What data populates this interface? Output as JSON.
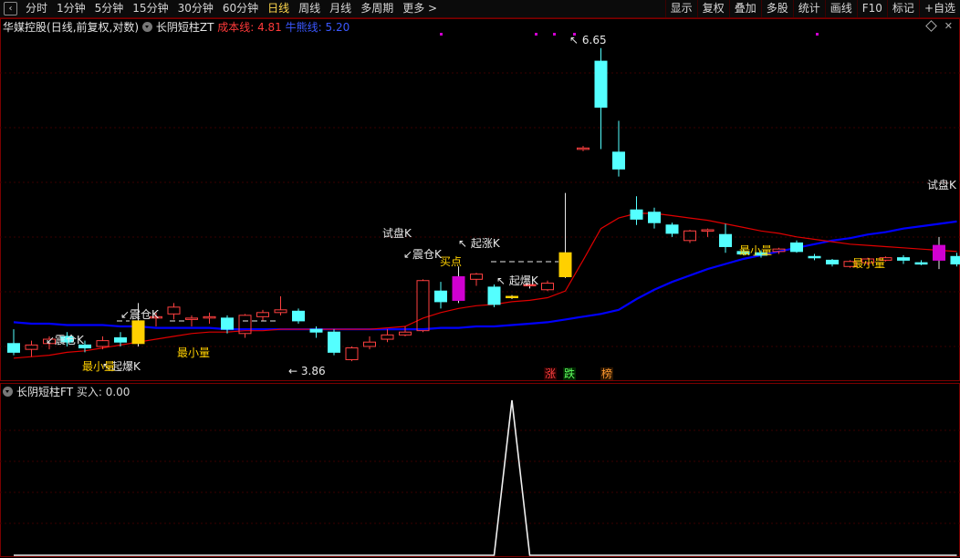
{
  "toolbar": {
    "left": [
      "分时",
      "1分钟",
      "5分钟",
      "15分钟",
      "30分钟",
      "60分钟",
      "日线",
      "周线",
      "月线",
      "多周期",
      "更多"
    ],
    "right": [
      "显示",
      "复权",
      "叠加",
      "多股",
      "统计",
      "画线",
      "F10",
      "标记",
      "+自选"
    ]
  },
  "header": {
    "stock_name": "华媒控股",
    "mode": "(日线,前复权,对数)",
    "indicator": "长阴短柱ZT",
    "cost_label": "成本线: 4.81",
    "bull_label": "牛熊线: 5.20"
  },
  "sub_header": {
    "indicator": "长阴短柱FT",
    "value_label": "买入: 0.00"
  },
  "annotations": {
    "high_price": "6.65",
    "low_price": "3.86",
    "shake_k": "震仓K",
    "trial_k": "试盘K",
    "surge_k": "起涨K",
    "burst_k": "起爆K",
    "min_volume": "最小量",
    "buy_point": "买点",
    "badge_rise": "涨",
    "badge_fall": "跌",
    "badge_list": "榜"
  },
  "colors": {
    "up": "#ff4040",
    "down": "#54ffff",
    "yellow": "#ffd000",
    "magenta": "#d000d0",
    "cost_line": "#e00000",
    "bull_line": "#0000ff",
    "white": "#e8e8e8"
  },
  "chart_data": {
    "type": "candlestick",
    "candles": [
      {
        "o": 3.98,
        "h": 4.08,
        "l": 3.9,
        "c": 3.92
      },
      {
        "o": 3.94,
        "h": 4.0,
        "l": 3.89,
        "c": 3.97
      },
      {
        "o": 3.98,
        "h": 4.03,
        "l": 3.94,
        "c": 4.01
      },
      {
        "o": 4.03,
        "h": 4.06,
        "l": 3.96,
        "c": 3.99
      },
      {
        "o": 3.97,
        "h": 4.0,
        "l": 3.92,
        "c": 3.95
      },
      {
        "o": 3.96,
        "h": 4.03,
        "l": 3.94,
        "c": 4.0
      },
      {
        "o": 4.02,
        "h": 4.06,
        "l": 3.96,
        "c": 3.99
      },
      {
        "o": 3.98,
        "h": 4.27,
        "l": 3.96,
        "c": 4.14,
        "color": "yellow"
      },
      {
        "o": 4.17,
        "h": 4.2,
        "l": 4.1,
        "c": 4.17
      },
      {
        "o": 4.19,
        "h": 4.27,
        "l": 4.15,
        "c": 4.24
      },
      {
        "o": 4.15,
        "h": 4.18,
        "l": 4.1,
        "c": 4.16
      },
      {
        "o": 4.16,
        "h": 4.2,
        "l": 4.12,
        "c": 4.17
      },
      {
        "o": 4.16,
        "h": 4.18,
        "l": 4.05,
        "c": 4.08
      },
      {
        "o": 4.05,
        "h": 4.19,
        "l": 4.02,
        "c": 4.18
      },
      {
        "o": 4.17,
        "h": 4.22,
        "l": 4.14,
        "c": 4.2
      },
      {
        "o": 4.2,
        "h": 4.32,
        "l": 4.18,
        "c": 4.22
      },
      {
        "o": 4.21,
        "h": 4.23,
        "l": 4.12,
        "c": 4.14
      },
      {
        "o": 4.08,
        "h": 4.1,
        "l": 4.02,
        "c": 4.06
      },
      {
        "o": 4.06,
        "h": 4.08,
        "l": 3.9,
        "c": 3.92
      },
      {
        "o": 3.87,
        "h": 3.96,
        "l": 3.86,
        "c": 3.95
      },
      {
        "o": 3.96,
        "h": 4.03,
        "l": 3.94,
        "c": 3.99
      },
      {
        "o": 4.01,
        "h": 4.08,
        "l": 3.99,
        "c": 4.04
      },
      {
        "o": 4.04,
        "h": 4.1,
        "l": 4.03,
        "c": 4.06
      },
      {
        "o": 4.07,
        "h": 4.45,
        "l": 4.06,
        "c": 4.44
      },
      {
        "o": 4.36,
        "h": 4.43,
        "l": 4.23,
        "c": 4.28
      },
      {
        "o": 4.29,
        "h": 4.55,
        "l": 4.27,
        "c": 4.47,
        "color": "magenta"
      },
      {
        "o": 4.45,
        "h": 4.5,
        "l": 4.4,
        "c": 4.49
      },
      {
        "o": 4.39,
        "h": 4.41,
        "l": 4.24,
        "c": 4.26
      },
      {
        "o": 4.31,
        "h": 4.33,
        "l": 4.3,
        "c": 4.32,
        "color": "yellow"
      },
      {
        "o": 4.4,
        "h": 4.42,
        "l": 4.38,
        "c": 4.41,
        "color": "red"
      },
      {
        "o": 4.37,
        "h": 4.44,
        "l": 4.36,
        "c": 4.42
      },
      {
        "o": 4.47,
        "h": 5.17,
        "l": 4.46,
        "c": 4.66,
        "color": "yellow"
      },
      {
        "o": 5.58,
        "h": 5.61,
        "l": 5.56,
        "c": 5.59
      },
      {
        "o": 6.5,
        "h": 6.65,
        "l": 5.58,
        "c": 6.0
      },
      {
        "o": 5.55,
        "h": 5.86,
        "l": 5.32,
        "c": 5.39
      },
      {
        "o": 5.02,
        "h": 5.14,
        "l": 4.89,
        "c": 4.94
      },
      {
        "o": 5.0,
        "h": 5.04,
        "l": 4.86,
        "c": 4.91
      },
      {
        "o": 4.89,
        "h": 4.91,
        "l": 4.79,
        "c": 4.82
      },
      {
        "o": 4.76,
        "h": 4.85,
        "l": 4.74,
        "c": 4.84
      },
      {
        "o": 4.84,
        "h": 4.86,
        "l": 4.79,
        "c": 4.85
      },
      {
        "o": 4.81,
        "h": 4.9,
        "l": 4.66,
        "c": 4.71
      },
      {
        "o": 4.67,
        "h": 4.69,
        "l": 4.64,
        "c": 4.65
      },
      {
        "o": 4.66,
        "h": 4.68,
        "l": 4.62,
        "c": 4.64
      },
      {
        "o": 4.67,
        "h": 4.7,
        "l": 4.65,
        "c": 4.69
      },
      {
        "o": 4.74,
        "h": 4.76,
        "l": 4.66,
        "c": 4.67
      },
      {
        "o": 4.63,
        "h": 4.65,
        "l": 4.6,
        "c": 4.62
      },
      {
        "o": 4.6,
        "h": 4.61,
        "l": 4.55,
        "c": 4.57
      },
      {
        "o": 4.55,
        "h": 4.6,
        "l": 4.54,
        "c": 4.59
      },
      {
        "o": 4.58,
        "h": 4.62,
        "l": 4.56,
        "c": 4.61
      },
      {
        "o": 4.6,
        "h": 4.63,
        "l": 4.59,
        "c": 4.62
      },
      {
        "o": 4.62,
        "h": 4.64,
        "l": 4.57,
        "c": 4.6
      },
      {
        "o": 4.58,
        "h": 4.6,
        "l": 4.56,
        "c": 4.57
      },
      {
        "o": 4.6,
        "h": 4.79,
        "l": 4.53,
        "c": 4.72,
        "color": "magenta"
      },
      {
        "o": 4.63,
        "h": 4.66,
        "l": 4.55,
        "c": 4.57
      }
    ],
    "cost_line": [
      3.88,
      3.89,
      3.9,
      3.92,
      3.93,
      3.95,
      3.97,
      3.99,
      4.01,
      4.03,
      4.05,
      4.06,
      4.06,
      4.07,
      4.07,
      4.08,
      4.08,
      4.08,
      4.08,
      4.08,
      4.08,
      4.09,
      4.1,
      4.16,
      4.2,
      4.23,
      4.25,
      4.26,
      4.28,
      4.29,
      4.31,
      4.36,
      4.6,
      4.86,
      4.95,
      4.99,
      4.99,
      4.97,
      4.95,
      4.93,
      4.9,
      4.87,
      4.84,
      4.82,
      4.79,
      4.77,
      4.75,
      4.73,
      4.72,
      4.71,
      4.7,
      4.69,
      4.68,
      4.67
    ],
    "bull_line": [
      4.13,
      4.12,
      4.12,
      4.11,
      4.11,
      4.11,
      4.1,
      4.1,
      4.09,
      4.09,
      4.09,
      4.09,
      4.08,
      4.08,
      4.08,
      4.08,
      4.08,
      4.08,
      4.08,
      4.08,
      4.08,
      4.08,
      4.08,
      4.08,
      4.09,
      4.09,
      4.1,
      4.1,
      4.11,
      4.12,
      4.13,
      4.15,
      4.17,
      4.19,
      4.22,
      4.3,
      4.37,
      4.43,
      4.48,
      4.53,
      4.57,
      4.61,
      4.64,
      4.67,
      4.7,
      4.73,
      4.76,
      4.78,
      4.81,
      4.83,
      4.86,
      4.88,
      4.9,
      4.92
    ],
    "sub_values": [
      0,
      0,
      0,
      0,
      0,
      0,
      0,
      0,
      0,
      0,
      0,
      0,
      0,
      0,
      0,
      0,
      0,
      0,
      0,
      0,
      0,
      0,
      0,
      0,
      0,
      0,
      0,
      0,
      1,
      0,
      0,
      0,
      0,
      0,
      0,
      0,
      0,
      0,
      0,
      0,
      0,
      0,
      0,
      0,
      0,
      0,
      0,
      0,
      0,
      0,
      0,
      0,
      0,
      0
    ]
  }
}
